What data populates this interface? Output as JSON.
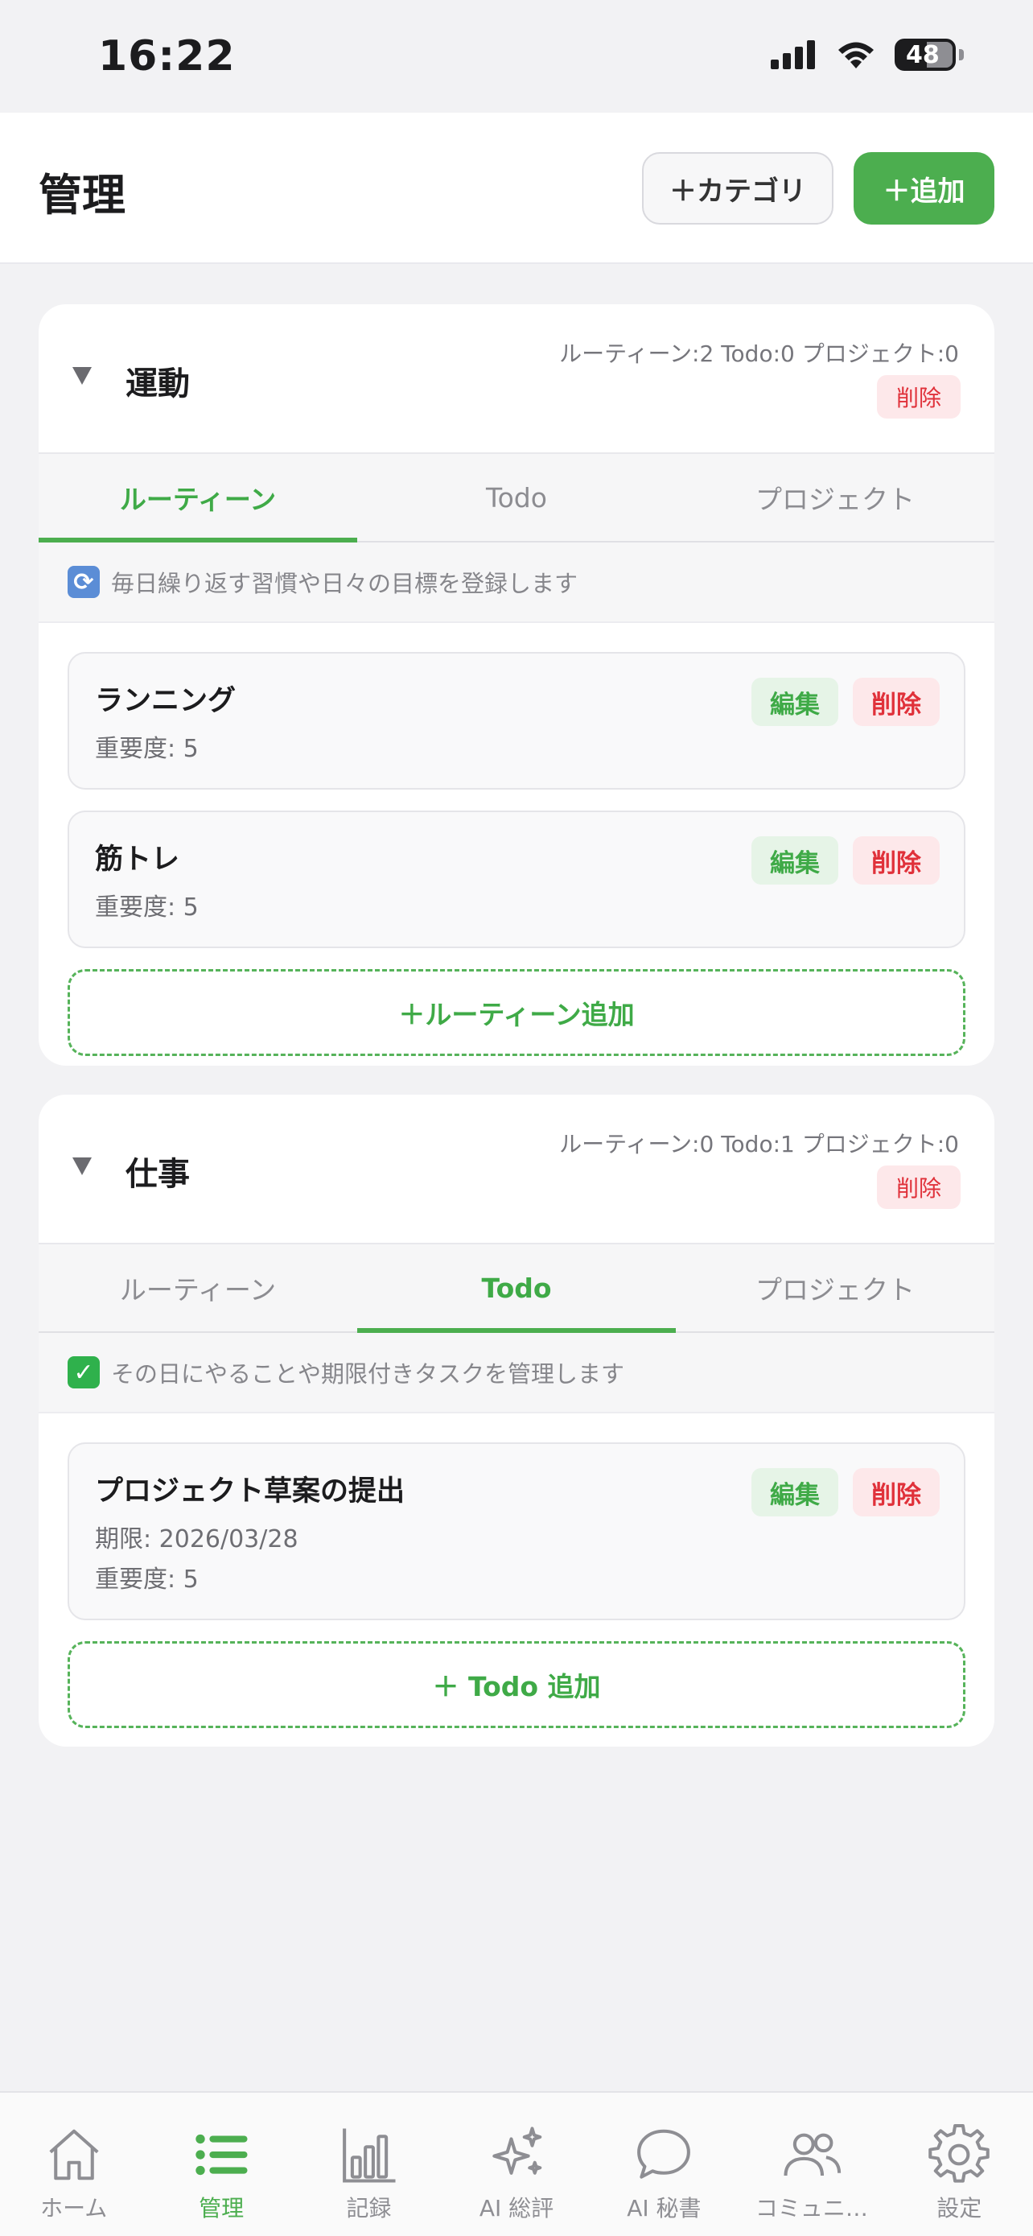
{
  "status": {
    "time": "16:22",
    "battery": "48"
  },
  "header": {
    "title": "管理",
    "category_button": "＋カテゴリ",
    "add_button": "＋追加"
  },
  "categories": [
    {
      "name": "運動",
      "counts": "ルーティーン:2 Todo:0 プロジェクト:0",
      "delete_label": "削除",
      "tabs": [
        "ルーティーン",
        "Todo",
        "プロジェクト"
      ],
      "active_tab": "ルーティーン",
      "description": "毎日繰り返す習慣や日々の目標を登録します",
      "items": [
        {
          "title": "ランニング",
          "meta": [
            "重要度: 5"
          ],
          "edit": "編集",
          "delete": "削除"
        },
        {
          "title": "筋トレ",
          "meta": [
            "重要度: 5"
          ],
          "edit": "編集",
          "delete": "削除"
        }
      ],
      "add_label": "＋ルーティーン追加"
    },
    {
      "name": "仕事",
      "counts": "ルーティーン:0 Todo:1 プロジェクト:0",
      "delete_label": "削除",
      "tabs": [
        "ルーティーン",
        "Todo",
        "プロジェクト"
      ],
      "active_tab": "Todo",
      "description": "その日にやることや期限付きタスクを管理します",
      "items": [
        {
          "title": "プロジェクト草案の提出",
          "meta": [
            "期限: 2026/03/28",
            "重要度: 5"
          ],
          "edit": "編集",
          "delete": "削除"
        }
      ],
      "add_label": "＋ Todo 追加"
    }
  ],
  "nav": [
    {
      "label": "ホーム",
      "icon": "home-icon"
    },
    {
      "label": "管理",
      "icon": "list-icon",
      "active": true
    },
    {
      "label": "記録",
      "icon": "bar-chart-icon"
    },
    {
      "label": "AI 総評",
      "icon": "sparkles-icon"
    },
    {
      "label": "AI 秘書",
      "icon": "chat-bubble-icon"
    },
    {
      "label": "コミュニ…",
      "icon": "people-icon"
    },
    {
      "label": "設定",
      "icon": "gear-icon"
    }
  ],
  "colors": {
    "accent": "#4cae4f",
    "danger": "#e0313a"
  }
}
